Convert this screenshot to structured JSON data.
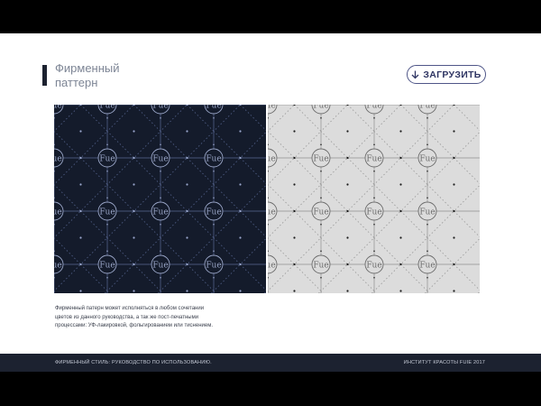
{
  "header": {
    "title_lines": [
      "Фирменный",
      "паттерн"
    ]
  },
  "download": {
    "label": "ЗАГРУЗИТЬ",
    "icon": "download-arrow-icon"
  },
  "patterns": {
    "dark": {
      "background": "#141b2b",
      "line_color": "#5a6a96",
      "dot_color": "#9ba8cf",
      "logo_color": "#9aa6c8"
    },
    "light": {
      "background": "#dcdcdc",
      "line_color": "#8f8f8f",
      "dot_color": "#1a1a1a",
      "logo_color": "#6b6b6b"
    },
    "logo_text": "Fue"
  },
  "description": {
    "lines": [
      "Фирменный патерн может исполняться в любом сочетании",
      "цветов из данного руководства, а так же пост-печатными",
      "процессами: УФ-лакировкой, фольгированием или тиснением."
    ]
  },
  "footer": {
    "left_text": "ФИРМЕННЫЙ СТИЛЬ: РУКОВОДСТВО ПО ИСПОЛЬЗОВАНИЮ.",
    "right_text": "ИНСТИТУТ КРАСОТЫ FUIE 2017"
  },
  "colors": {
    "brand_dark": "#1c2230",
    "accent": "#4f5688",
    "page_background": "#ffffff"
  }
}
